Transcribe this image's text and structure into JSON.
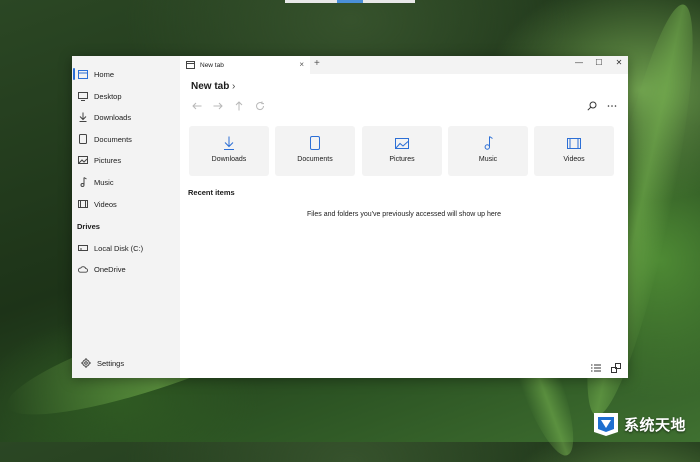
{
  "window": {
    "tab_label": "New tab",
    "new_tab_symbol": "+",
    "close_tab_symbol": "×",
    "controls": {
      "minimize": "—",
      "maximize": "☐",
      "close": "✕"
    }
  },
  "sidebar": {
    "items": [
      {
        "label": "Home",
        "icon": "home-icon",
        "active": true
      },
      {
        "label": "Desktop",
        "icon": "desktop-icon"
      },
      {
        "label": "Downloads",
        "icon": "download-icon"
      },
      {
        "label": "Documents",
        "icon": "document-icon"
      },
      {
        "label": "Pictures",
        "icon": "picture-icon"
      },
      {
        "label": "Music",
        "icon": "music-icon"
      },
      {
        "label": "Videos",
        "icon": "video-icon"
      }
    ],
    "drives_title": "Drives",
    "drives": [
      {
        "label": "Local Disk (C:)",
        "icon": "drive-icon"
      },
      {
        "label": "OneDrive",
        "icon": "cloud-icon"
      }
    ],
    "settings_label": "Settings"
  },
  "main": {
    "title": "New tab",
    "title_chevron": "›",
    "tiles": [
      {
        "label": "Downloads",
        "icon": "download-icon"
      },
      {
        "label": "Documents",
        "icon": "document-icon"
      },
      {
        "label": "Pictures",
        "icon": "picture-icon"
      },
      {
        "label": "Music",
        "icon": "music-icon"
      },
      {
        "label": "Videos",
        "icon": "video-icon"
      }
    ],
    "recent_title": "Recent items",
    "recent_empty": "Files and folders you've previously accessed will show up here"
  },
  "watermark": {
    "text": "系统天地"
  },
  "colors": {
    "accent": "#2c6fd6",
    "sidebar_bg": "#f3f3f3",
    "tile_bg": "#f3f3f3"
  }
}
